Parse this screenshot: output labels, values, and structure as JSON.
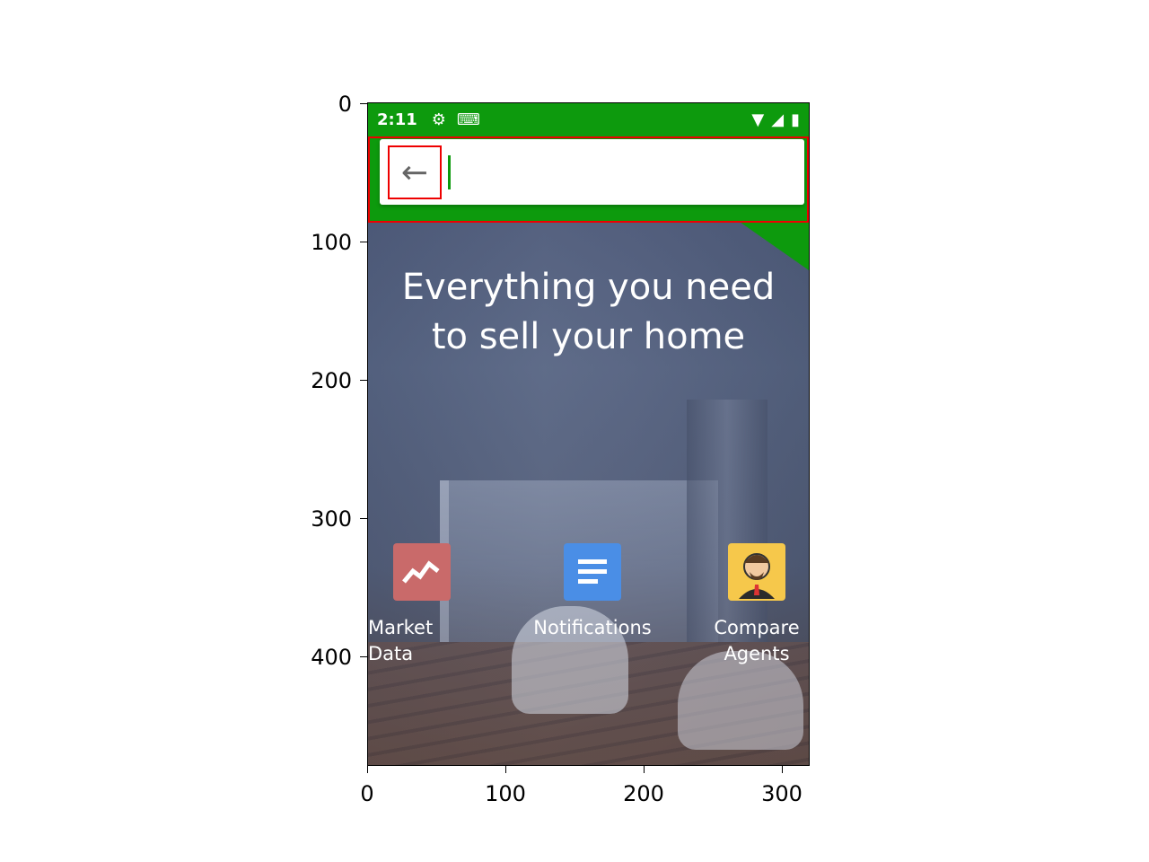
{
  "axes": {
    "y_ticks": [
      "0",
      "100",
      "200",
      "300",
      "400"
    ],
    "x_ticks": [
      "0",
      "100",
      "200",
      "300"
    ]
  },
  "status_bar": {
    "time": "2:11",
    "icons": [
      "gear-icon",
      "keyboard-icon",
      "wifi-icon",
      "signal-icon",
      "battery-icon"
    ]
  },
  "search": {
    "back_icon": "arrow-left-icon",
    "placeholder": "",
    "value": ""
  },
  "hero": {
    "line1": "Everything you need",
    "line2": "to sell your home"
  },
  "features": [
    {
      "label_line1": "Market",
      "label_line2": "Data",
      "icon": "trend-chart-icon",
      "color": "#c96a6a"
    },
    {
      "label_line1": "Notifications",
      "label_line2": "",
      "icon": "document-lines-icon",
      "color": "#4a8ee6"
    },
    {
      "label_line1": "Compare",
      "label_line2": "Agents",
      "icon": "agent-avatar-icon",
      "color": "#f6c84b"
    }
  ],
  "colors": {
    "brand_green": "#0d9a0d",
    "annotation_red": "#e00000"
  }
}
